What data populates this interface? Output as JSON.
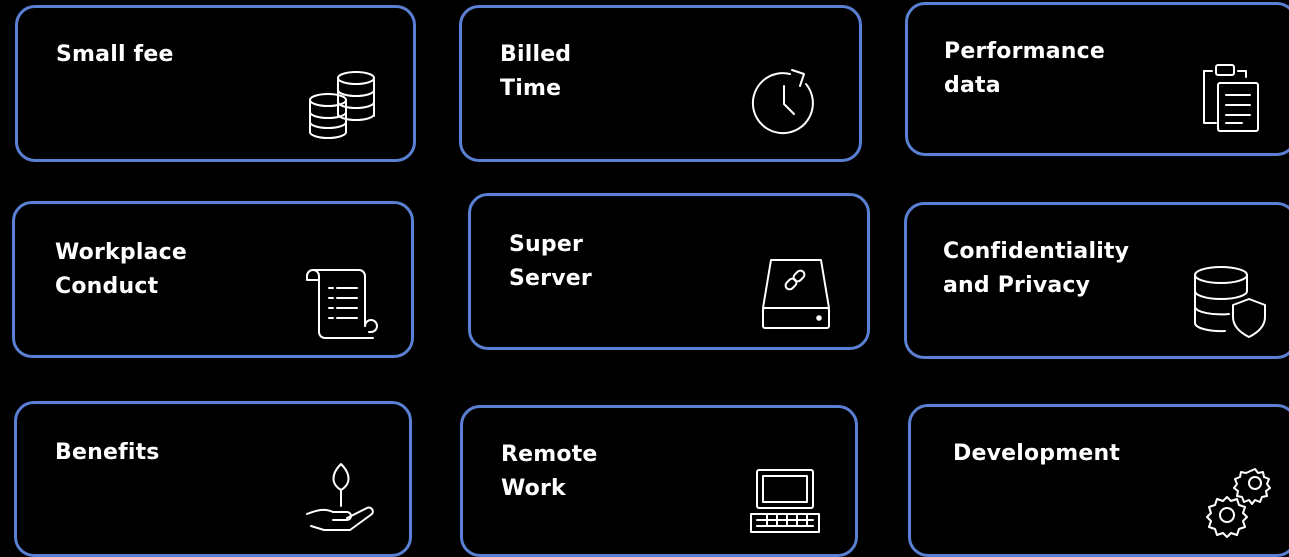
{
  "colors": {
    "background": "#000000",
    "card_border": "#5b7fd3",
    "text": "#ffffff"
  },
  "cards": [
    {
      "label": "Small fee",
      "icon": "coins-stack-icon"
    },
    {
      "label": "Billed\nTime",
      "icon": "clock-refresh-icon"
    },
    {
      "label": "Performance\ndata",
      "icon": "clipboard-copy-icon"
    },
    {
      "label": "Workplace\nConduct",
      "icon": "scroll-document-icon"
    },
    {
      "label": "Super\nServer",
      "icon": "linked-drive-icon"
    },
    {
      "label": "Confidentiality\nand Privacy",
      "icon": "database-shield-icon"
    },
    {
      "label": "Benefits",
      "icon": "hand-plant-icon"
    },
    {
      "label": "Remote\nWork",
      "icon": "laptop-icon"
    },
    {
      "label": "Development",
      "icon": "gears-icon"
    }
  ]
}
